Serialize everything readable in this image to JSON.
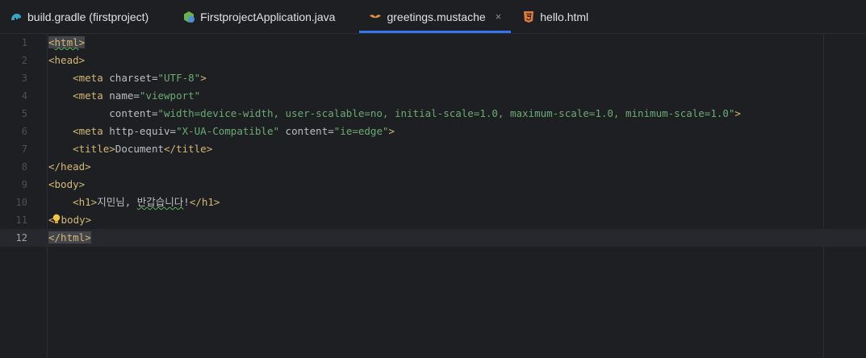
{
  "tabs": [
    {
      "label": "build.gradle (firstproject)",
      "icon": "gradle-icon",
      "active": false
    },
    {
      "label": "FirstprojectApplication.java",
      "icon": "spring-boot-icon",
      "active": false
    },
    {
      "label": "greetings.mustache",
      "icon": "mustache-icon",
      "active": true
    },
    {
      "label": "hello.html",
      "icon": "html5-icon",
      "active": false
    }
  ],
  "tab_close_symbol": "×",
  "editor": {
    "current_line": 12,
    "lines": [
      {
        "num": "1",
        "code": "<html>"
      },
      {
        "num": "2",
        "code": "<head>"
      },
      {
        "num": "3",
        "code": "    <meta charset=\"UTF-8\">"
      },
      {
        "num": "4",
        "code": "    <meta name=\"viewport\""
      },
      {
        "num": "5",
        "code": "          content=\"width=device-width, user-scalable=no, initial-scale=1.0, maximum-scale=1.0, minimum-scale=1.0\">"
      },
      {
        "num": "6",
        "code": "    <meta http-equiv=\"X-UA-Compatible\" content=\"ie=edge\">"
      },
      {
        "num": "7",
        "code": "    <title>Document</title>"
      },
      {
        "num": "8",
        "code": "</head>"
      },
      {
        "num": "9",
        "code": "<body>"
      },
      {
        "num": "10",
        "code": "    <h1>지민님, 반갑습니다!</h1>"
      },
      {
        "num": "11",
        "code": "</body>"
      },
      {
        "num": "12",
        "code": "</html>"
      }
    ]
  },
  "colors": {
    "background": "#1e1f22",
    "tag": "#d5b778",
    "attribute": "#bcbec4",
    "attr_value": "#6aab73",
    "accent": "#3574f0"
  }
}
